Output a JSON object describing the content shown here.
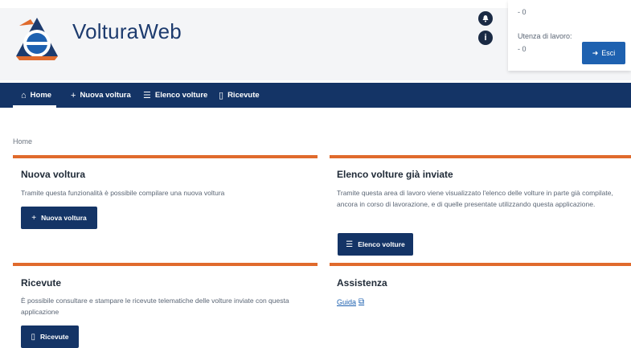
{
  "header": {
    "app_title": "VolturaWeb",
    "user_panel": {
      "line1": "- 0",
      "line2": "Utenza di lavoro:",
      "line3": "- 0",
      "logout_label": "Esci"
    }
  },
  "nav": {
    "items": [
      {
        "label": "Home",
        "icon": "home-icon"
      },
      {
        "label": "Nuova voltura",
        "icon": "plus-icon"
      },
      {
        "label": "Elenco volture",
        "icon": "list-icon"
      },
      {
        "label": "Ricevute",
        "icon": "document-icon"
      }
    ]
  },
  "breadcrumb": "Home",
  "cards": {
    "nuova": {
      "title": "Nuova voltura",
      "text": "Tramite questa funzionalità è possibile compilare una nuova voltura",
      "button": "Nuova voltura"
    },
    "elenco": {
      "title": "Elenco volture già inviate",
      "text": "Tramite questa area di lavoro viene visualizzato l'elenco delle volture in parte già compilate, ancora in corso di lavorazione, e di quelle presentate utilizzando questa applicazione.",
      "button": "Elenco volture"
    },
    "ricevute": {
      "title": "Ricevute",
      "text": "È possibile consultare e stampare le ricevute telematiche delle volture inviate con questa applicazione",
      "button": "Ricevute"
    },
    "assistenza": {
      "title": "Assistenza",
      "link": "Guida"
    }
  },
  "colors": {
    "nav_bg": "#143466",
    "accent_orange": "#e06a2c",
    "primary_button": "#1e61b0"
  }
}
